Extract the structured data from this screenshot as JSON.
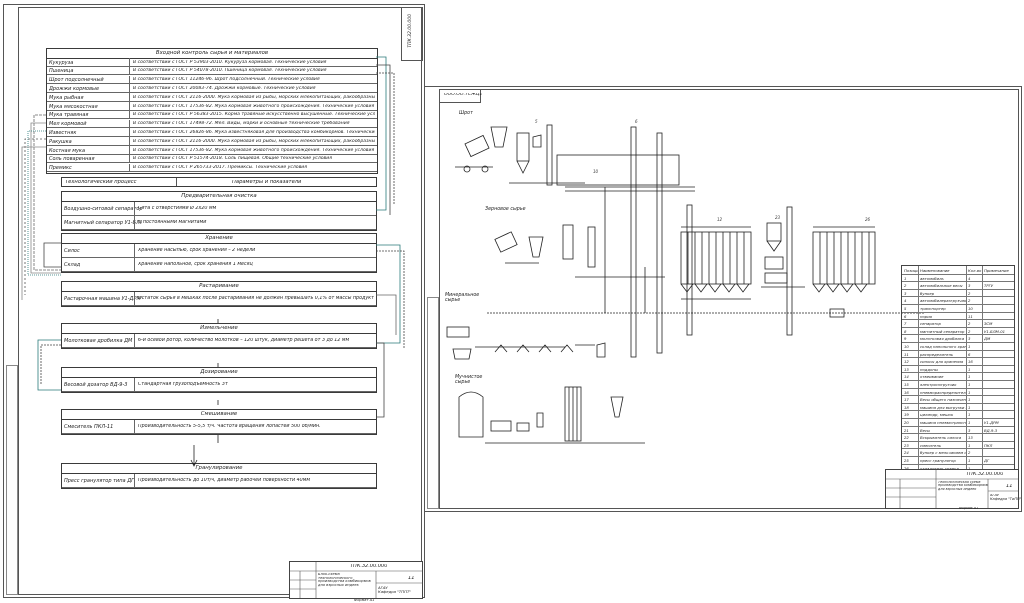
{
  "left_sheet": {
    "code": "ТПК.32.00.000",
    "input_control": {
      "header": "Входной контроль сырья и материалов",
      "rows": [
        {
          "name": "Кукуруза",
          "std": "В соответствии с ГОСТ Р 53903-2010. Кукуруза кормовая. Технические условия"
        },
        {
          "name": "Пшеница",
          "std": "В соответствии с ГОСТ Р 54078-2010. Пшеница кормовая. Технические условия"
        },
        {
          "name": "Шрот подсолнечный",
          "std": "В соответствии с ГОСТ 11246-96. Шрот подсолнечный. Технические условия"
        },
        {
          "name": "Дрожжи кормовые",
          "std": "В соответствии с ГОСТ 20083-74. Дрожжи кормовые. Технические условия"
        },
        {
          "name": "Мука рыбная",
          "std": "В соответствии с ГОСТ 2116-2000. Мука кормовая из рыбы, морских млекопитающих, ракообразных и беспозвоночных. Технические условия"
        },
        {
          "name": "Мука мясокостная",
          "std": "В соответствии с ГОСТ 17536-82. Мука кормовая животного происхождения. Технические условия"
        },
        {
          "name": "Мука травяная",
          "std": "В соответствии с ГОСТ Р 56383-2015. Корма травяные искусственно высушенные. Технические условия"
        },
        {
          "name": "Мел кормовой",
          "std": "В соответствии с ГОСТ 17498-72. Мел. Виды, марки и основные технические требования"
        },
        {
          "name": "Известняк",
          "std": "В соответствии с ГОСТ 26826-86. Мука известняковая для производства комбикормов. Технические условия"
        },
        {
          "name": "Ракушка",
          "std": "В соответствии с ГОСТ 2116-2000. Мука кормовая из рыбы, морских млекопитающих, ракообразных и беспозвоночных. Технические условия"
        },
        {
          "name": "Костная мука",
          "std": "В соответствии с ГОСТ 17536-82. Мука кормовая животного происхождения. Технические условия"
        },
        {
          "name": "Соль поваренная",
          "std": "В соответствии с ГОСТ Р 51574-2018. Соль пищевая. Общие технические условия"
        },
        {
          "name": "Премикс",
          "std": "В соответствии с ГОСТ Р 265733-2017. Премиксы. Технические условия"
        }
      ]
    },
    "process_header": {
      "left": "Технологический процесс",
      "right": "Параметры и показатели"
    },
    "stages": [
      {
        "title": "Предварительная очистка",
        "rows": [
          {
            "name": "Воздушно-ситовой сепаратор ЗСМ",
            "param": "Сита с отверстиями Ø 2х20 мм"
          },
          {
            "name": "Магнитный сепаратор У1-БЛМ-01",
            "param": "С постоянными магнитами"
          }
        ]
      },
      {
        "title": "Хранение",
        "rows": [
          {
            "name": "Силос",
            "param": "Хранение насыпью, срок хранения – 2 недели"
          },
          {
            "name": "Склад",
            "param": "Хранение напольное, срок хранения 1 месяц"
          }
        ]
      },
      {
        "title": "Растаривание",
        "rows": [
          {
            "name": "Растарочная машина У1-ДРМ",
            "param": "Остаток сырья в мешках после растаривания не должен превышать 0,1% от массы продукта в мешке"
          }
        ]
      },
      {
        "title": "Измельчение",
        "rows": [
          {
            "name": "Молотковая дробилка ДМ",
            "param": "6-и осевой ротор, количество молотков – 120 штук, диаметр решета от 3 до 12 мм"
          }
        ]
      },
      {
        "title": "Дозирование",
        "rows": [
          {
            "name": "Весовой дозатор ВД-9-3",
            "param": "Стандартная грузоподъемность 3т"
          }
        ]
      },
      {
        "title": "Смешивание",
        "rows": [
          {
            "name": "Смеситель ПКЛ-11",
            "param": "Производительность 5-5,5 т/ч. Частота вращения лопастей 500 об/мин."
          }
        ]
      },
      {
        "title": "Гранулирование",
        "rows": [
          {
            "name": "Пресс гранулятор типа ДГ",
            "param": "Производительность до 10т/ч, диаметр рабочей поверхности 40мм"
          }
        ]
      }
    ],
    "stamp": {
      "code": "ТПК.32.00.000",
      "title": "Блок-схема технологического производства комбикормов для взрослых индеек",
      "sheet": "11",
      "org": "АГАУ\nКафедра \"ТППТ\"",
      "format": "Формат А1"
    }
  },
  "right_sheet": {
    "corner_code": "ООО.ОО.ТСЖЦ1",
    "labels": {
      "shrot": "Шрот",
      "grain": "Зерновое сырье",
      "mineral": "Минеральное сырье",
      "flour": "Мучнистое сырье"
    },
    "spec": {
      "header": [
        "Позиция",
        "Наименование",
        "Кол-во",
        "Примечание"
      ],
      "rows": [
        [
          "1",
          "автомобиль",
          "4",
          ""
        ],
        [
          "2",
          "автомобильные весы",
          "3",
          "ТРГУ"
        ],
        [
          "3",
          "бункер",
          "2",
          ""
        ],
        [
          "4",
          "автомобилеразгрузчик",
          "2",
          ""
        ],
        [
          "5",
          "транспортер",
          "10",
          ""
        ],
        [
          "6",
          "нория",
          "11",
          ""
        ],
        [
          "7",
          "сепаратор",
          "2",
          "ЗСМ"
        ],
        [
          "8",
          "магнитный сепаратор",
          "2",
          "У1-БЛМ-01"
        ],
        [
          "9",
          "молотковая дробилка",
          "3",
          "ДМ"
        ],
        [
          "10",
          "склад напольного хранения",
          "1",
          ""
        ],
        [
          "11",
          "распределитель",
          "6",
          ""
        ],
        [
          "12",
          "силосы для хранения",
          "16",
          ""
        ],
        [
          "13",
          "поддоны",
          "1",
          ""
        ],
        [
          "14",
          "отвеивание",
          "1",
          ""
        ],
        [
          "15",
          "электропогрузчик",
          "1",
          ""
        ],
        [
          "16",
          "пневмораспределитель",
          "1",
          ""
        ],
        [
          "17",
          "Весы общего назначения",
          "1",
          ""
        ],
        [
          "18",
          "машина для выгрузки мешков",
          "1",
          ""
        ],
        [
          "19",
          "цилиндр, мешок",
          "1",
          ""
        ],
        [
          "20",
          "машина пневмотранспорта",
          "1",
          "У1-ДРМ"
        ],
        [
          "21",
          "Весы",
          "3",
          "ВД-9-3"
        ],
        [
          "22",
          "Вскрыватель силоса",
          "13",
          ""
        ],
        [
          "23",
          "смеситель",
          "1",
          "ПКЛ"
        ],
        [
          "24",
          "бункер с мельчанием сбоку",
          "2",
          ""
        ],
        [
          "25",
          "пресс гранулятор",
          "1",
          "ДГ"
        ],
        [
          "26",
          "охладитель гранул",
          "1",
          ""
        ],
        [
          "27",
          "норий-питатель",
          "1",
          ""
        ]
      ]
    },
    "stamp": {
      "code": "ТПК.32.00.000",
      "title": "Технологическая схема производства комбикормов для взрослых индеек",
      "sheet": "11",
      "org": "АГАУ\nКафедра \"ТиПП\"",
      "format": "Формат А1"
    }
  }
}
